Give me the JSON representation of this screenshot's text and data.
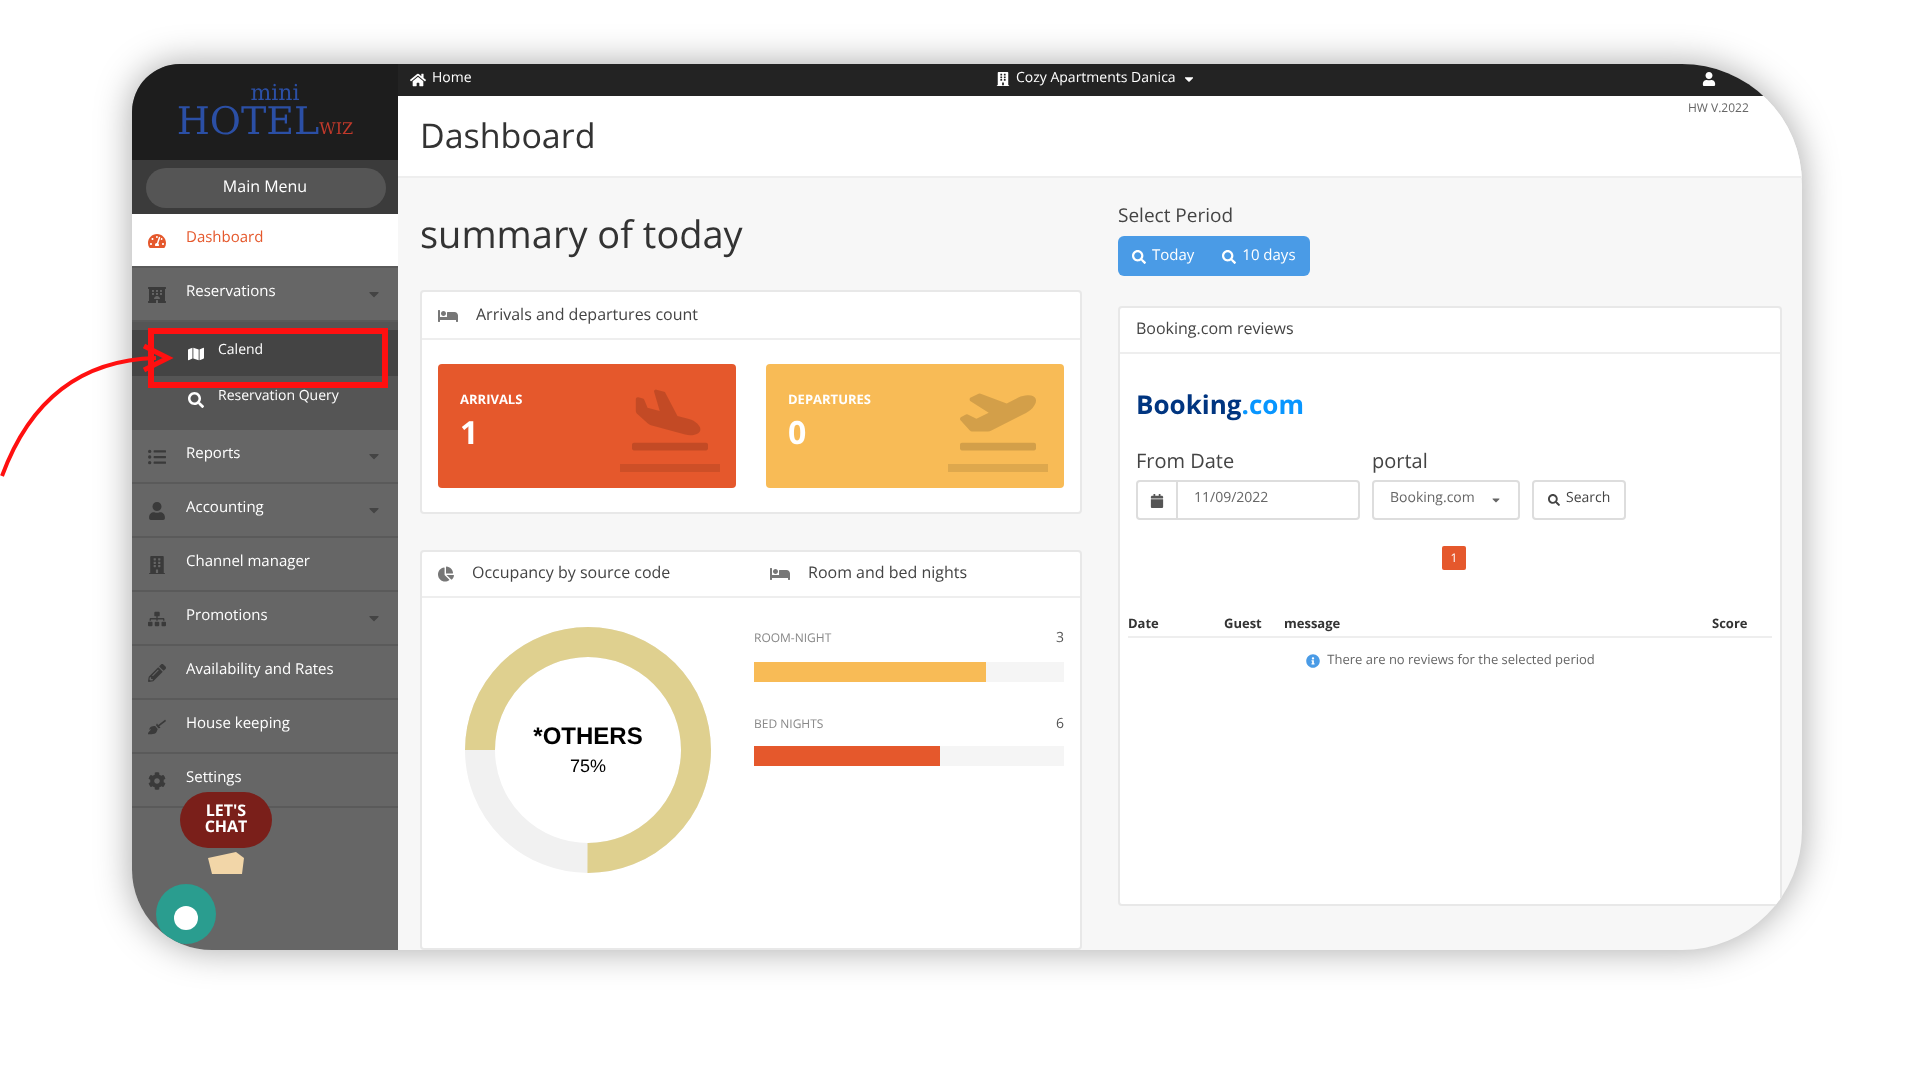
{
  "topbar": {
    "home": "Home",
    "property": "Cozy Apartments Danica",
    "version": "HW V.2022"
  },
  "logo": {
    "small": "mini",
    "main": "HOTEL",
    "suffix": "WIZ"
  },
  "sidebar": {
    "menu_button": "Main Menu",
    "items": [
      {
        "label": "Dashboard",
        "selected": true,
        "has_caret": false
      },
      {
        "label": "Reservations",
        "selected": false,
        "has_caret": true,
        "expanded": true,
        "children": [
          {
            "label": "Calend",
            "selected": true
          },
          {
            "label": "Reservation Query",
            "selected": false
          }
        ]
      },
      {
        "label": "Reports",
        "selected": false,
        "has_caret": true
      },
      {
        "label": "Accounting",
        "selected": false,
        "has_caret": true
      },
      {
        "label": "Channel manager",
        "selected": false,
        "has_caret": false
      },
      {
        "label": "Promotions",
        "selected": false,
        "has_caret": true
      },
      {
        "label": "Availability and Rates",
        "selected": false,
        "has_caret": false
      },
      {
        "label": "House keeping",
        "selected": false,
        "has_caret": false
      },
      {
        "label": "Settings",
        "selected": false,
        "has_caret": false
      }
    ]
  },
  "chat_badge": {
    "line1": "LET'S",
    "line2": "CHAT"
  },
  "page": {
    "title": "Dashboard",
    "summary_title": "summary of today"
  },
  "arrivals_panel": {
    "title": "Arrivals and departures count",
    "tiles": [
      {
        "label": "ARRIVALS",
        "value": "1",
        "color": "#e5582c"
      },
      {
        "label": "DEPARTURES",
        "value": "0",
        "color": "#f8bb56"
      }
    ]
  },
  "occupancy": {
    "title": "Occupancy by source code",
    "center_label": "*OTHERS",
    "center_value": "75%",
    "level": 0.75
  },
  "nights": {
    "title": "Room and bed nights",
    "rows": [
      {
        "label": "ROOM-NIGHT",
        "value": "3",
        "level": 0.75,
        "color": "#f8bb56"
      },
      {
        "label": "BED NIGHTS",
        "value": "6",
        "level": 0.6,
        "color": "#e5582c"
      }
    ]
  },
  "period": {
    "label": "Select Period",
    "buttons": [
      "Today",
      "10 days"
    ]
  },
  "reviews": {
    "title": "Booking.com reviews",
    "brand": "Booking",
    "brand_suffix": ".com",
    "from_label": "From Date",
    "date_value": "11/09/2022",
    "portal_label": "portal",
    "portal_value": "Booking.com",
    "search": "Search",
    "page": "1",
    "columns": [
      "Date",
      "Guest",
      "message",
      "Score"
    ],
    "empty": "There are no reviews for the selected period"
  }
}
